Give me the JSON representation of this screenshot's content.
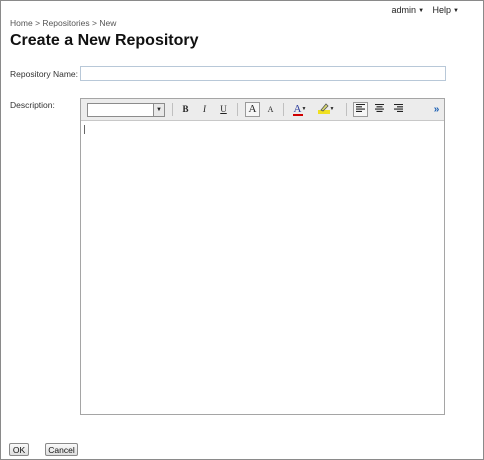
{
  "usermenu": {
    "user": "admin",
    "help": "Help"
  },
  "breadcrumb": {
    "home": "Home",
    "sep1": ">",
    "repositories": "Repositories",
    "sep2": ">",
    "current": "New"
  },
  "page_title": "Create a New Repository",
  "form": {
    "name_label": "Repository Name:",
    "name_value": "",
    "description_label": "Description:"
  },
  "editor": {
    "font_value": "",
    "toolbar": {
      "bold": "B",
      "italic": "I",
      "underline": "U",
      "grow": "A",
      "shrink": "A",
      "font_color": "A",
      "more": "»"
    },
    "colors": {
      "font_color_bar": "#d00000",
      "highlight_bar": "#f0e020",
      "more_arrows": "#1a5fb4"
    }
  },
  "buttons": {
    "ok": "OK",
    "cancel": "Cancel"
  }
}
